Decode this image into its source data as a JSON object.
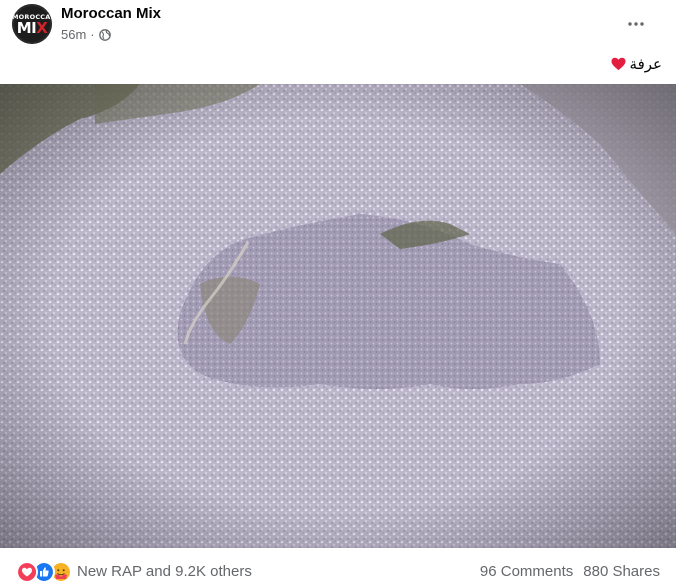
{
  "post": {
    "page_name": "Moroccan Mix",
    "time_ago": "56m",
    "separator": "·",
    "caption_text": "عرفة",
    "avatar_logo_top": "MOROCCAN",
    "avatar_logo_mi": "MI",
    "avatar_logo_x": "X"
  },
  "engagement": {
    "reactions_summary": "New RAP and 9.2K others",
    "comments": "96 Comments",
    "shares": "880 Shares"
  },
  "colors": {
    "text_primary": "#050505",
    "text_secondary": "#65676b",
    "heart": "#e41e3f",
    "like": "#1877f2"
  }
}
